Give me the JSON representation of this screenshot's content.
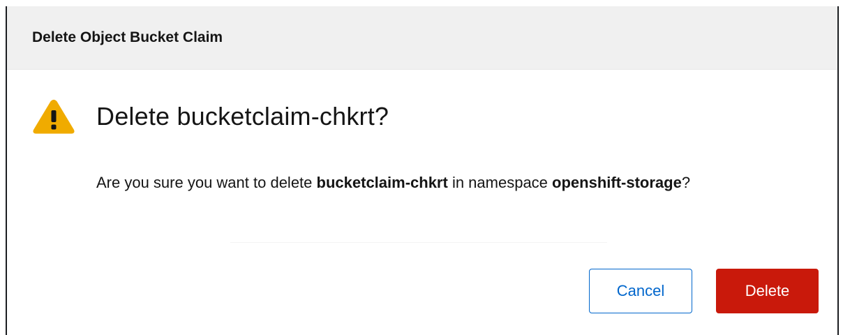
{
  "modal": {
    "header_title": "Delete Object Bucket Claim",
    "heading": "Delete bucketclaim-chkrt?",
    "message": {
      "prefix": "Are you sure you want to delete ",
      "resource_name": "bucketclaim-chkrt",
      "middle": " in namespace ",
      "namespace": "openshift-storage",
      "suffix": "?"
    },
    "icon": "warning-triangle-icon",
    "buttons": {
      "cancel_label": "Cancel",
      "delete_label": "Delete"
    }
  },
  "colors": {
    "warning": "#f0ab00",
    "danger": "#c9190b",
    "link": "#0066cc",
    "header_bg": "#f0f0f0"
  }
}
